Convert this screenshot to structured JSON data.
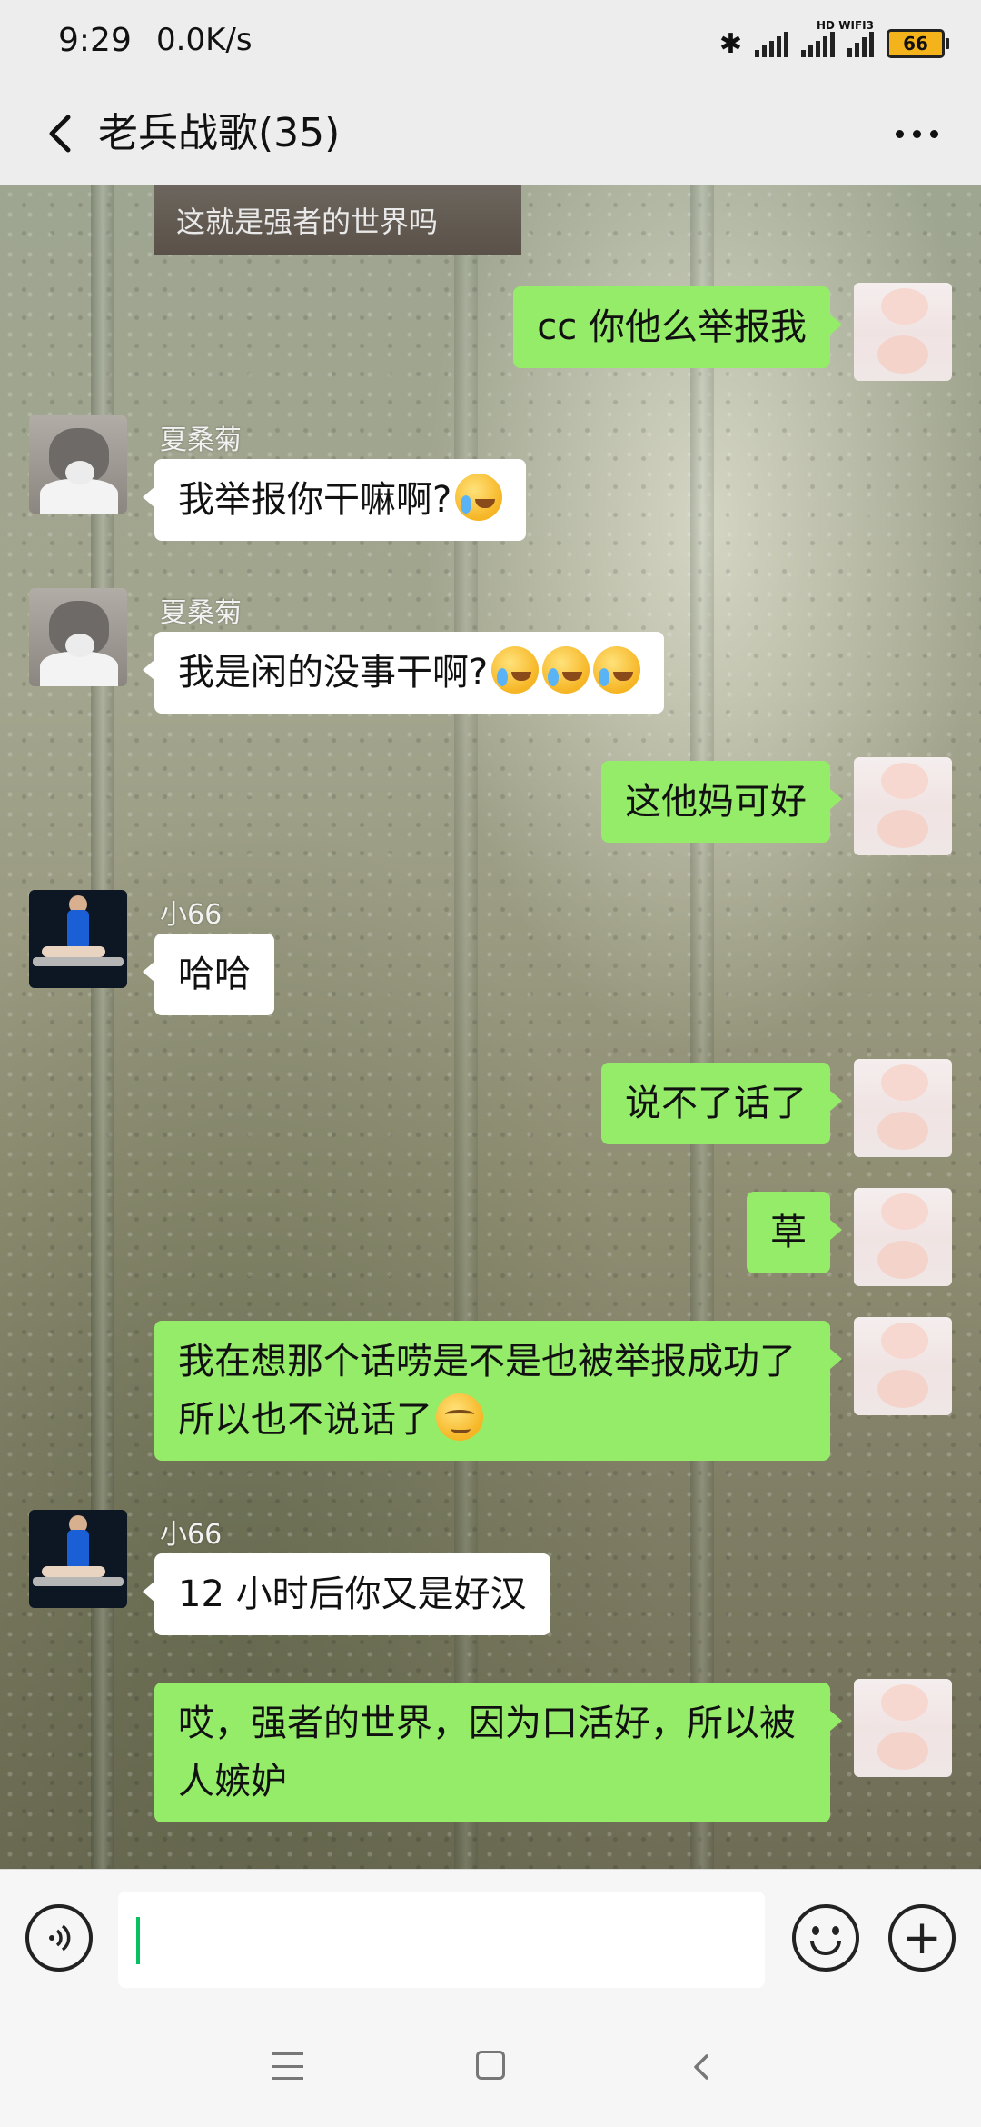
{
  "status_bar": {
    "time": "9:29",
    "speed": "0.0K/s",
    "bluetooth": "bluetooth-icon",
    "signal1_label": "",
    "signal2_label": "HD",
    "wifi_label": "WIFI3",
    "battery": "66"
  },
  "header": {
    "title": "老兵战歌(35)",
    "back_icon": "chevron-left-icon",
    "more_icon": "more-dots-icon"
  },
  "chat": {
    "top_image_caption": "这就是强者的世界吗",
    "messages": [
      {
        "side": "right",
        "text": "cc 你他么举报我"
      },
      {
        "side": "left",
        "sender": "夏桑菊",
        "text": "我举报你干嘛啊?",
        "emoji": "cry-laugh"
      },
      {
        "side": "left",
        "sender": "夏桑菊",
        "text": "我是闲的没事干啊?",
        "emoji": "cry-laugh x3"
      },
      {
        "side": "right",
        "text": "这他妈可好"
      },
      {
        "side": "left",
        "sender": "小66",
        "text": "哈哈"
      },
      {
        "side": "right",
        "text": "说不了话了"
      },
      {
        "side": "right",
        "text": "草"
      },
      {
        "side": "right",
        "text": "我在想那个话唠是不是也被举报成功了所以也不说话了",
        "emoji": "smirk"
      },
      {
        "side": "left",
        "sender": "小66",
        "text": "12 小时后你又是好汉"
      },
      {
        "side": "right",
        "text": "哎，强者的世界，因为口活好，所以被人嫉妒"
      }
    ]
  },
  "input_bar": {
    "voice_icon": "voice-icon",
    "emoji_icon": "emoji-face-icon",
    "plus_icon": "plus-icon",
    "text_value": ""
  },
  "colors": {
    "bubble_green": "#95ec69",
    "bubble_white": "#ffffff",
    "caret": "#07c160"
  }
}
